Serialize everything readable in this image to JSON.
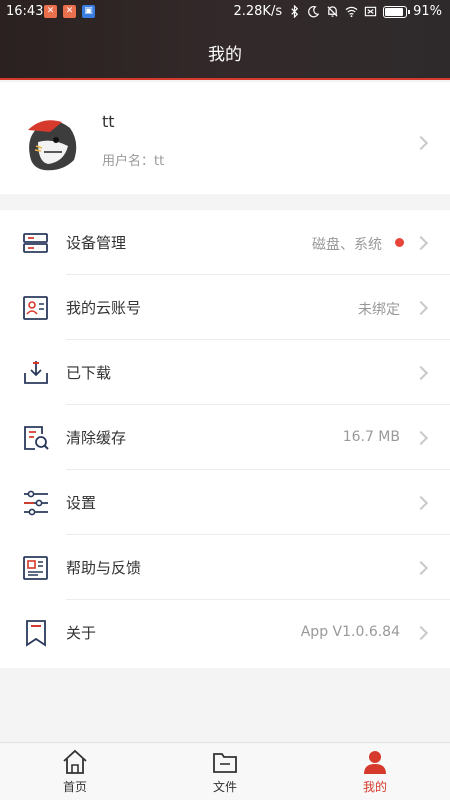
{
  "status_bar": {
    "time": "16:43",
    "network_speed": "2.28K/s",
    "battery": "91%"
  },
  "header": {
    "title": "我的"
  },
  "profile": {
    "name": "tt",
    "username_label": "用户名：tt"
  },
  "menu": [
    {
      "label": "设备管理",
      "value": "磁盘、系统",
      "icon": "device-management-icon",
      "has_dot": true
    },
    {
      "label": "我的云账号",
      "value": "未绑定",
      "icon": "cloud-account-icon"
    },
    {
      "label": "已下载",
      "value": "",
      "icon": "downloaded-icon"
    },
    {
      "label": "清除缓存",
      "value": "16.7 MB",
      "icon": "clear-cache-icon"
    },
    {
      "label": "设置",
      "value": "",
      "icon": "settings-sliders-icon"
    },
    {
      "label": "帮助与反馈",
      "value": "",
      "icon": "help-feedback-icon"
    },
    {
      "label": "关于",
      "value": "App V1.0.6.84",
      "icon": "about-bookmark-icon"
    }
  ],
  "bottom_nav": [
    {
      "label": "首页",
      "icon": "home-icon",
      "active": false
    },
    {
      "label": "文件",
      "icon": "folder-icon",
      "active": false
    },
    {
      "label": "我的",
      "icon": "user-icon",
      "active": true
    }
  ],
  "colors": {
    "accent": "#d63a2c",
    "icon_navy": "#2b3a5c",
    "notification_dot": "#e8453a"
  }
}
